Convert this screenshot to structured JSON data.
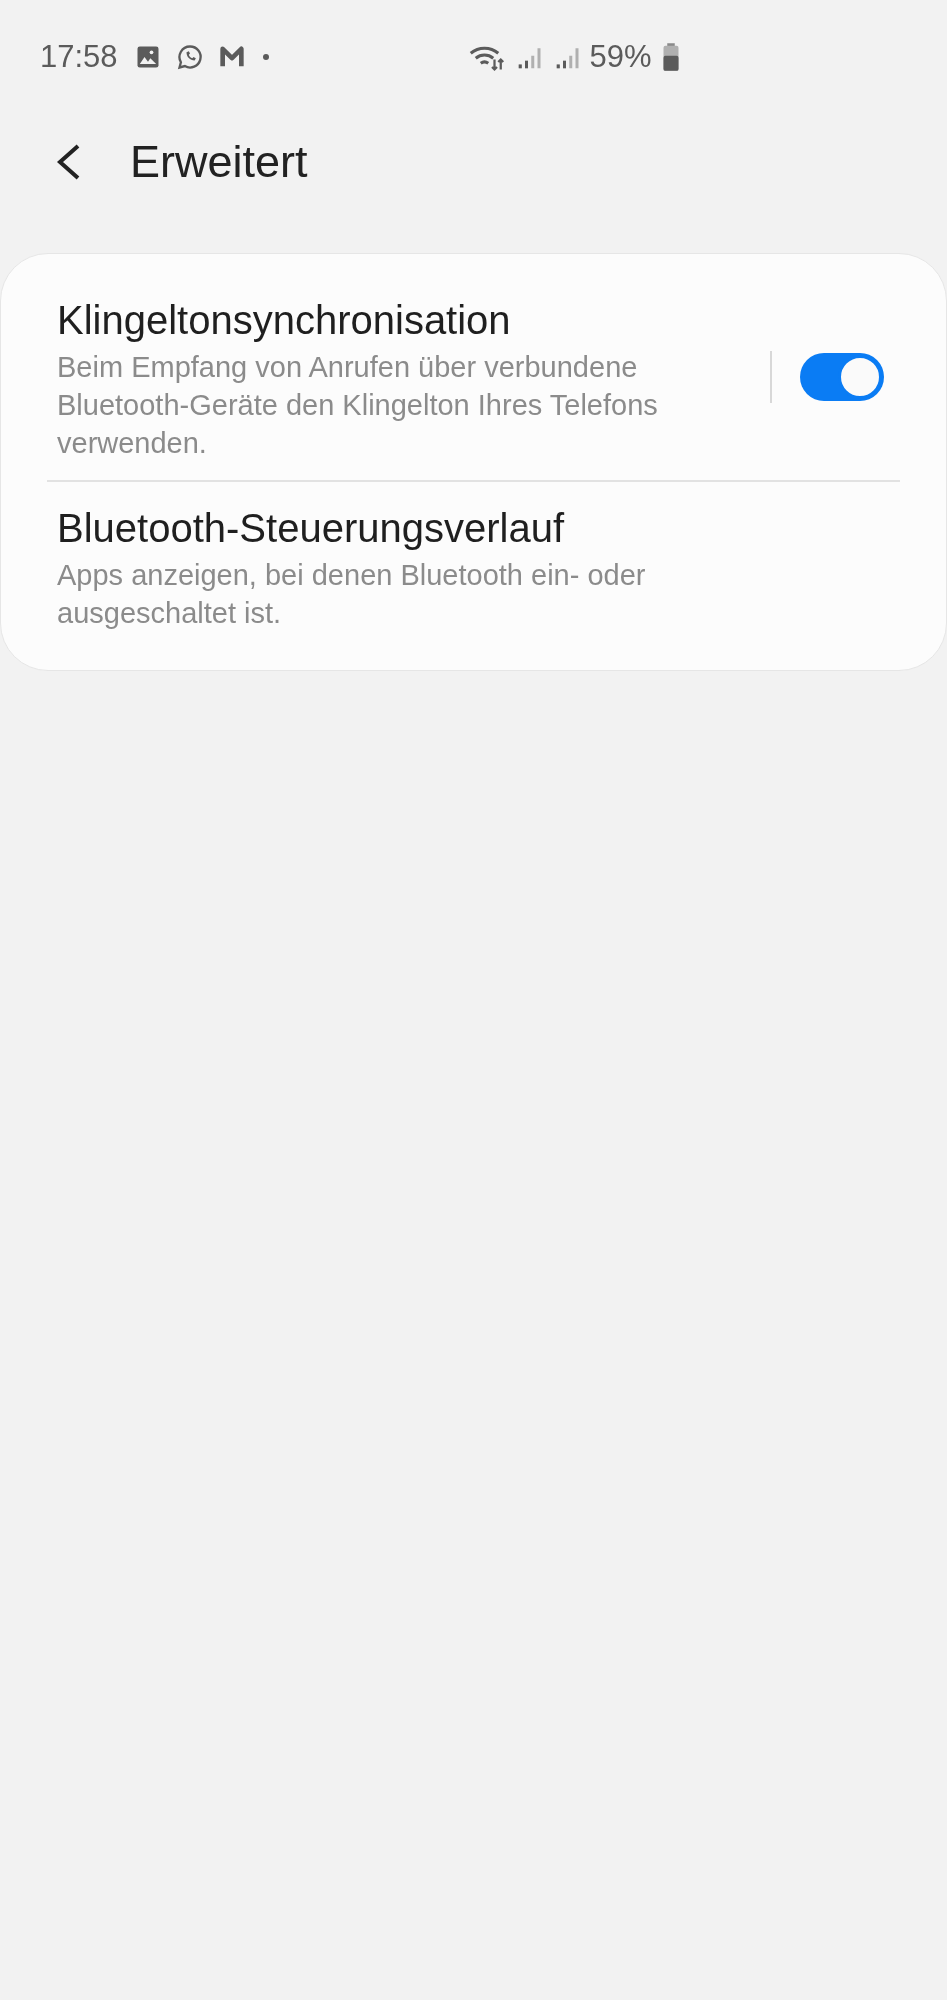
{
  "status_bar": {
    "time": "17:58",
    "battery": "59%"
  },
  "header": {
    "title": "Erweitert"
  },
  "items": [
    {
      "kind": "switch",
      "title": "Klingeltonsynchronisation",
      "description": "Beim Empfang von Anrufen über verbundene Bluetooth-Geräte den Klingelton Ihres Telefons verwenden.",
      "on": true
    },
    {
      "kind": "link",
      "title": "Bluetooth-Steuerungsverlauf",
      "description": "Apps anzeigen, bei denen Bluetooth ein- oder ausgeschaltet ist."
    }
  ]
}
